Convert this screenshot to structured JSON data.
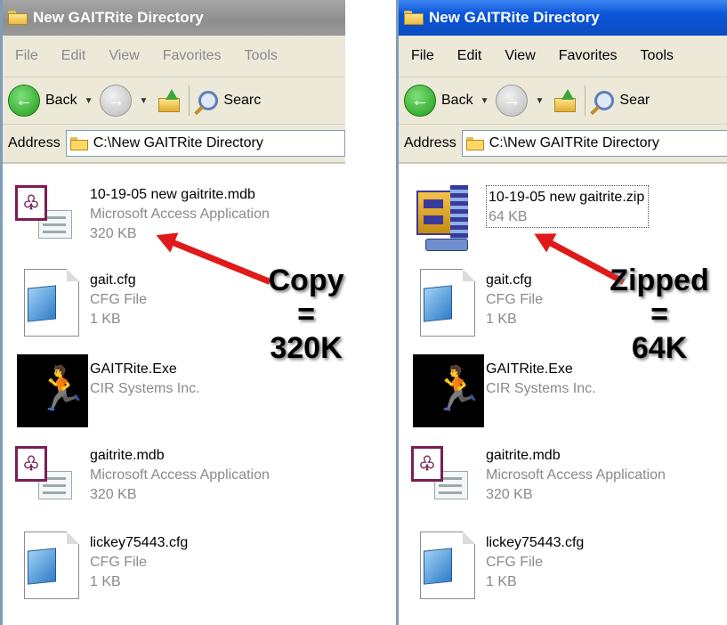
{
  "left_window": {
    "title": "New GAITRite Directory",
    "menu": [
      "File",
      "Edit",
      "View",
      "Favorites",
      "Tools"
    ],
    "toolbar": {
      "back_label": "Back",
      "search_label": "Searc"
    },
    "address_label": "Address",
    "address_value": "C:\\New GAITRite Directory",
    "files": [
      {
        "name": "10-19-05 new gaitrite.mdb",
        "type": "Microsoft Access Application",
        "size": "320 KB",
        "icon": "access-icon"
      },
      {
        "name": "gait.cfg",
        "type": "CFG File",
        "size": "1 KB",
        "icon": "cfg-icon"
      },
      {
        "name": "GAITRite.Exe",
        "type": "CIR Systems Inc.",
        "size": "",
        "icon": "exe-icon"
      },
      {
        "name": "gaitrite.mdb",
        "type": "Microsoft Access Application",
        "size": "320 KB",
        "icon": "access-icon"
      },
      {
        "name": "lickey75443.cfg",
        "type": "CFG File",
        "size": "1 KB",
        "icon": "cfg-icon"
      }
    ]
  },
  "right_window": {
    "title": "New GAITRite Directory",
    "menu": [
      "File",
      "Edit",
      "View",
      "Favorites",
      "Tools"
    ],
    "toolbar": {
      "back_label": "Back",
      "search_label": "Sear"
    },
    "address_label": "Address",
    "address_value": "C:\\New GAITRite Directory",
    "files": [
      {
        "name": "10-19-05 new gaitrite.zip",
        "type": "",
        "size": "64 KB",
        "icon": "zip-icon"
      },
      {
        "name": "gait.cfg",
        "type": "CFG File",
        "size": "1 KB",
        "icon": "cfg-icon"
      },
      {
        "name": "GAITRite.Exe",
        "type": "CIR Systems Inc.",
        "size": "",
        "icon": "exe-icon"
      },
      {
        "name": "gaitrite.mdb",
        "type": "Microsoft Access Application",
        "size": "320 KB",
        "icon": "access-icon"
      },
      {
        "name": "lickey75443.cfg",
        "type": "CFG File",
        "size": "1 KB",
        "icon": "cfg-icon"
      }
    ]
  },
  "annotations": {
    "left": {
      "line1": "Copy",
      "line2": "=",
      "line3": "320K"
    },
    "right": {
      "line1": "Zipped",
      "line2": "=",
      "line3": "64K"
    }
  },
  "colors": {
    "arrow": "#e01a1a",
    "active_titlebar": "#0a55d8",
    "inactive_titlebar": "#9a9a9a"
  }
}
